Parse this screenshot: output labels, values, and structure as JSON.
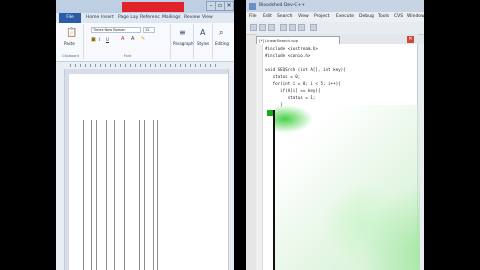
{
  "word": {
    "tabs": [
      "File",
      "Home",
      "Insert",
      "Page Lay",
      "Referenc",
      "Mailings",
      "Review",
      "View"
    ],
    "font": {
      "name": "Times New Roman",
      "size": "12"
    },
    "groups": {
      "clipboard": "Clipboard",
      "paste": "Paste",
      "font": "Font",
      "paragraph": "Paragraph",
      "styles": "Styles",
      "editing": "Editing"
    },
    "format_buttons": [
      "B",
      "I",
      "U"
    ],
    "title_controls": [
      "–",
      "▫",
      "✕"
    ]
  },
  "dev": {
    "title": "Bloodshed Dev-C++",
    "menu": [
      "File",
      "Edit",
      "Search",
      "View",
      "Project",
      "Execute",
      "Debug",
      "Tools",
      "CVS",
      "Window"
    ],
    "tab_label": "[*] LinearSearch.cpp",
    "close_symbol": "✕",
    "code": [
      "#include <iostream.h>",
      "#include <conio.h>",
      "",
      "void SEQSrch (int A[], int key){",
      "   status = 0;",
      "   for(int i = 0; i < 5; i++){",
      "      if(A[i] == key){",
      "         status = 1;",
      "      }"
    ]
  },
  "colors": {
    "word_title_highlight": "#e0222a",
    "word_file_tab": "#2a5ca8",
    "breakpoint": "#1aa81a"
  }
}
